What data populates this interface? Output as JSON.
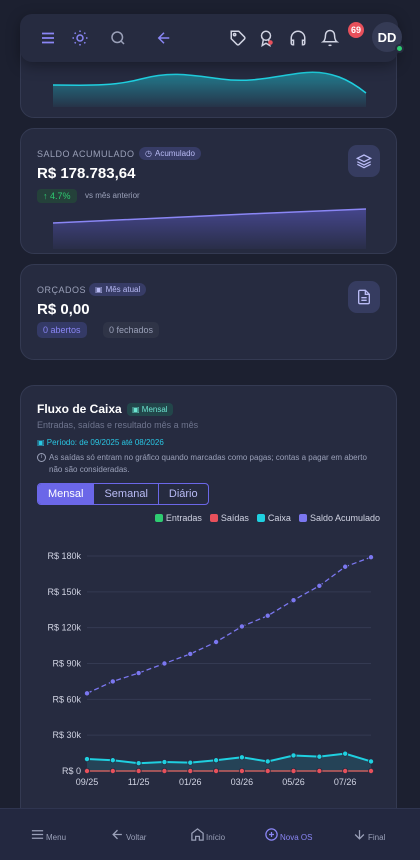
{
  "topbar": {
    "icons": [
      "menu-icon",
      "sun-icon",
      "search-icon",
      "back-arrow-icon",
      "tag-icon",
      "award-icon",
      "headset-icon",
      "bell-icon"
    ],
    "notification_count": "69",
    "user_initials": "DD",
    "accent": "#6b67e8"
  },
  "saldo": {
    "label": "SALDO ACUMULADO",
    "badge": "Acumulado",
    "value": "R$ 178.783,64",
    "trend": "↑ 4.7%",
    "trend_text": "vs mês anterior",
    "icon": "layers-icon"
  },
  "orcados": {
    "label": "ORÇADOS",
    "badge": "Mês atual",
    "value": "R$ 0,00",
    "abertos": "0 abertos",
    "fechados": "0 fechados",
    "icon": "document-icon"
  },
  "fluxo": {
    "title": "Fluxo de Caixa",
    "badge": "Mensal",
    "subtitle": "Entradas, saídas e resultado mês a mês",
    "period": "Período: de 09/2025 até 08/2026",
    "note": "As saídas só entram no gráfico quando marcadas como pagas; contas a pagar em aberto não são consideradas.",
    "tabs": [
      "Mensal",
      "Semanal",
      "Diário"
    ],
    "active_tab": "Mensal"
  },
  "chart_data": {
    "type": "line",
    "x": [
      "09/25",
      "10/25",
      "11/25",
      "12/25",
      "01/26",
      "02/26",
      "03/26",
      "04/26",
      "05/26",
      "06/26",
      "07/26",
      "08/26"
    ],
    "x_tick_labels": [
      "09/25",
      "11/25",
      "01/26",
      "03/26",
      "05/26",
      "07/26"
    ],
    "y_tick_labels": [
      "R$ 0",
      "R$ 30k",
      "R$ 60k",
      "R$ 90k",
      "R$ 120k",
      "R$ 150k",
      "R$ 180k"
    ],
    "ylim": [
      0,
      180000
    ],
    "grid": true,
    "legend_position": "top-right",
    "series": [
      {
        "name": "Entradas",
        "color": "#2ecc71",
        "values": [
          0,
          0,
          0,
          0,
          0,
          0,
          0,
          0,
          0,
          0,
          0,
          0
        ]
      },
      {
        "name": "Saídas",
        "color": "#e8505b",
        "values": [
          0,
          0,
          0,
          0,
          0,
          0,
          0,
          0,
          0,
          0,
          0,
          0
        ]
      },
      {
        "name": "Caixa",
        "color": "#1fd0e0",
        "values": [
          10000,
          9000,
          6500,
          7500,
          7000,
          9000,
          11500,
          8000,
          13000,
          12000,
          14500,
          8000
        ]
      },
      {
        "name": "Saldo Acumulado",
        "color": "#7b77f0",
        "values": [
          65000,
          75000,
          82000,
          90000,
          98000,
          108000,
          121000,
          130000,
          143000,
          155000,
          171000,
          179000
        ]
      }
    ]
  },
  "bottom_nav": [
    {
      "label": "Menu",
      "icon": "menu-icon"
    },
    {
      "label": "Voltar",
      "icon": "arrow-left-icon"
    },
    {
      "label": "Início",
      "icon": "home-icon"
    },
    {
      "label": "Nova OS",
      "icon": "plus-circle-icon"
    },
    {
      "label": "Final",
      "icon": "arrow-down-icon"
    }
  ]
}
